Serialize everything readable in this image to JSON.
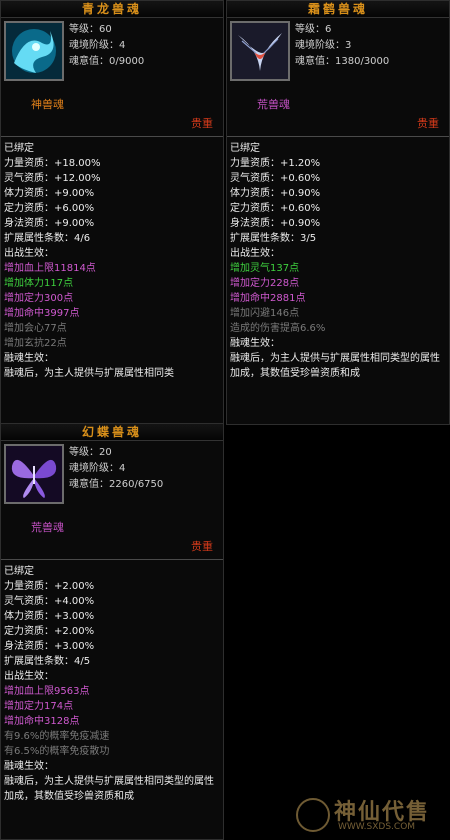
{
  "cards": [
    {
      "title": "青龙兽魂",
      "level": "等级：60",
      "realm": "魂境阶级：4",
      "soul": "魂意值：0/9000",
      "type": "神兽魂",
      "rarity": "贵重",
      "bound": "已绑定",
      "stats": [
        "力量资质：+18.00%",
        "灵气资质：+12.00%",
        "体力资质：+9.00%",
        "定力资质：+6.00%",
        "身法资质：+9.00%"
      ],
      "ext_count": "扩展属性条数：4/6",
      "effect_title": "出战生效：",
      "effects": [
        "增加血上限11814点",
        "增加体力117点",
        "增加定力300点",
        "增加命中3997点",
        "增加会心77点",
        "增加玄抗22点"
      ],
      "fusion_title": "融魂生效：",
      "fusion_text": "融魂后，为主人提供与扩展属性相同类"
    },
    {
      "title": "霜鹤兽魂",
      "level": "等级：6",
      "realm": "魂境阶级：3",
      "soul": "魂意值：1380/3000",
      "type": "荒兽魂",
      "rarity": "贵重",
      "bound": "已绑定",
      "stats": [
        "力量资质：+1.20%",
        "灵气资质：+0.60%",
        "体力资质：+0.90%",
        "定力资质：+0.60%",
        "身法资质：+0.90%"
      ],
      "ext_count": "扩展属性条数：3/5",
      "effect_title": "出战生效：",
      "effects": [
        "增加灵气137点",
        "增加定力228点",
        "增加命中2881点",
        "增加闪避146点",
        "造成的伤害提高6.6%"
      ],
      "fusion_title": "融魂生效：",
      "fusion_text": "融魂后，为主人提供与扩展属性相同类型的属性加成，其数值受珍兽资质和成"
    },
    {
      "title": "幻蝶兽魂",
      "level": "等级：20",
      "realm": "魂境阶级：4",
      "soul": "魂意值：2260/6750",
      "type": "荒兽魂",
      "rarity": "贵重",
      "bound": "已绑定",
      "stats": [
        "力量资质：+2.00%",
        "灵气资质：+4.00%",
        "体力资质：+3.00%",
        "定力资质：+2.00%",
        "身法资质：+3.00%"
      ],
      "ext_count": "扩展属性条数：4/5",
      "effect_title": "出战生效：",
      "effects": [
        "增加血上限9563点",
        "增加定力174点",
        "增加命中3128点",
        "有9.6%的概率免疫减速",
        "有6.5%的概率免疫散功"
      ],
      "fusion_title": "融魂生效：",
      "fusion_text": "融魂后，为主人提供与扩展属性相同类型的属性加成，其数值受珍兽资质和成"
    }
  ],
  "colors": {
    "title": "#d9901a",
    "rarity": "#d43a1a",
    "divine_type": "#e0801a",
    "wild_type": "#c050c0",
    "pink": "#d05ad0",
    "green": "#3ed03e",
    "grey": "#7a7a7a"
  },
  "watermark": {
    "text": "神仙代售",
    "url": "WWW.SXDS.COM"
  }
}
